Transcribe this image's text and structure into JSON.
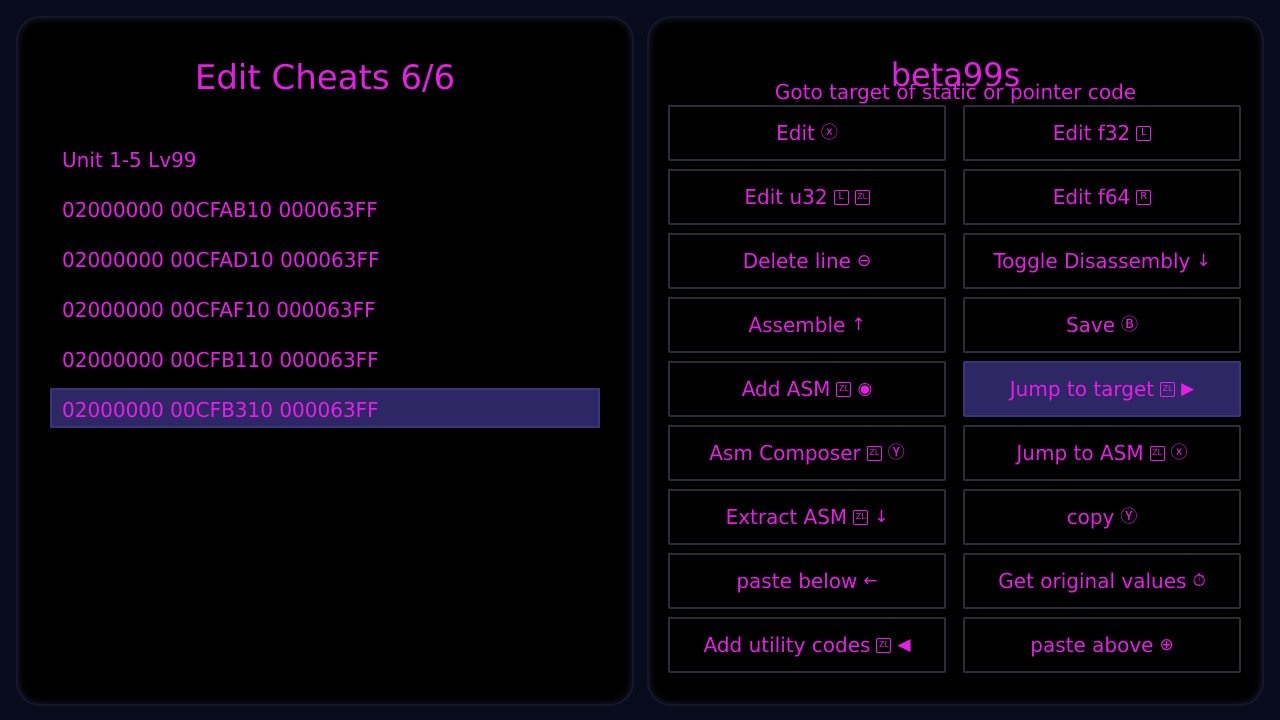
{
  "left_panel": {
    "title": "Edit Cheats 6/6",
    "items": [
      "Unit 1-5 Lv99",
      "02000000 00CFAB10 000063FF",
      "02000000 00CFAD10 000063FF",
      "02000000 00CFAF10 000063FF",
      "02000000 00CFB110 000063FF",
      "02000000 00CFB310 000063FF"
    ],
    "selected_index": 5
  },
  "right_panel": {
    "title": "beta99s",
    "subtitle": "Goto target of static or pointer code",
    "buttons": [
      {
        "label": "Edit",
        "glyphs": [
          "ⓧ"
        ]
      },
      {
        "label": "Edit f32",
        "keys": [
          "L"
        ]
      },
      {
        "label": "Edit u32",
        "keys": [
          "L",
          "ZL"
        ]
      },
      {
        "label": "Edit f64",
        "keys": [
          "R"
        ]
      },
      {
        "label": "Delete line",
        "glyphs": [
          "⊖"
        ]
      },
      {
        "label": "Toggle Disassembly",
        "glyphs": [
          "↓"
        ]
      },
      {
        "label": "Assemble",
        "glyphs": [
          "↑"
        ]
      },
      {
        "label": "Save",
        "glyphs": [
          "Ⓑ"
        ]
      },
      {
        "label": "Add ASM",
        "keys": [
          "ZL"
        ],
        "glyphs": [
          "◉"
        ]
      },
      {
        "label": "Jump to target",
        "keys": [
          "ZL"
        ],
        "glyphs": [
          "▶"
        ],
        "active": true
      },
      {
        "label": "Asm Composer",
        "keys": [
          "ZL"
        ],
        "glyphs": [
          "Ⓨ"
        ]
      },
      {
        "label": "Jump to ASM",
        "keys": [
          "ZL"
        ],
        "glyphs": [
          "ⓧ"
        ]
      },
      {
        "label": "Extract ASM",
        "keys": [
          "ZL"
        ],
        "glyphs": [
          "↓"
        ]
      },
      {
        "label": "copy",
        "glyphs": [
          "Ⓨ"
        ]
      },
      {
        "label": "paste below",
        "glyphs": [
          "←"
        ]
      },
      {
        "label": "Get original values",
        "glyphs": [
          "⏱"
        ]
      },
      {
        "label": "Add utility codes",
        "keys": [
          "ZL"
        ],
        "glyphs": [
          "◀"
        ]
      },
      {
        "label": "paste above",
        "glyphs": [
          "⊕"
        ]
      }
    ]
  },
  "colors": {
    "accent": "#e61ee6",
    "selected_bg": "#2e2766",
    "panel_bg": "#000000",
    "screen_bg": "#080b1c"
  }
}
